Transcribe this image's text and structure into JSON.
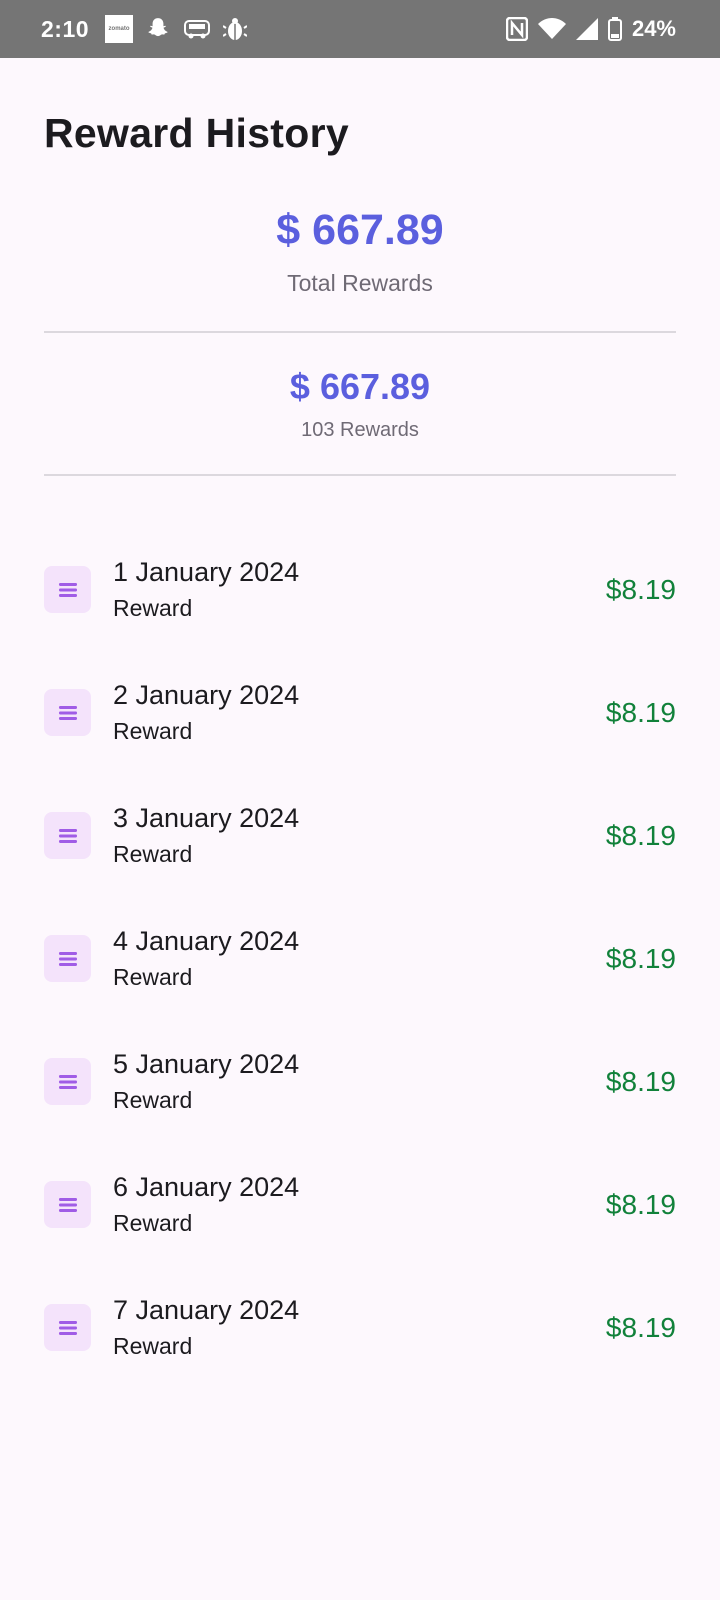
{
  "status_bar": {
    "time": "2:10",
    "battery": "24%",
    "left_icons": [
      "zomato-icon",
      "snapchat-icon",
      "redbus-icon",
      "bug-icon"
    ],
    "right_icons": [
      "nfc-icon",
      "wifi-icon",
      "signal-icon",
      "battery-icon"
    ],
    "zomato_text": "zomato"
  },
  "header": {
    "title": "Reward History"
  },
  "summary": {
    "total_amount": "$ 667.89",
    "total_label": "Total Rewards",
    "sub_amount": "$ 667.89",
    "sub_label": "103 Rewards"
  },
  "rewards": [
    {
      "date": "1 January 2024",
      "type": "Reward",
      "amount": "$8.19"
    },
    {
      "date": "2 January 2024",
      "type": "Reward",
      "amount": "$8.19"
    },
    {
      "date": "3 January 2024",
      "type": "Reward",
      "amount": "$8.19"
    },
    {
      "date": "4 January 2024",
      "type": "Reward",
      "amount": "$8.19"
    },
    {
      "date": "5 January 2024",
      "type": "Reward",
      "amount": "$8.19"
    },
    {
      "date": "6 January 2024",
      "type": "Reward",
      "amount": "$8.19"
    },
    {
      "date": "7 January 2024",
      "type": "Reward",
      "amount": "$8.19"
    }
  ],
  "colors": {
    "accent": "#5b5fde",
    "amount_positive": "#11813a",
    "icon_bg": "#f4e3fb",
    "icon_fg": "#a05ce6",
    "background": "#fdf8fd"
  }
}
